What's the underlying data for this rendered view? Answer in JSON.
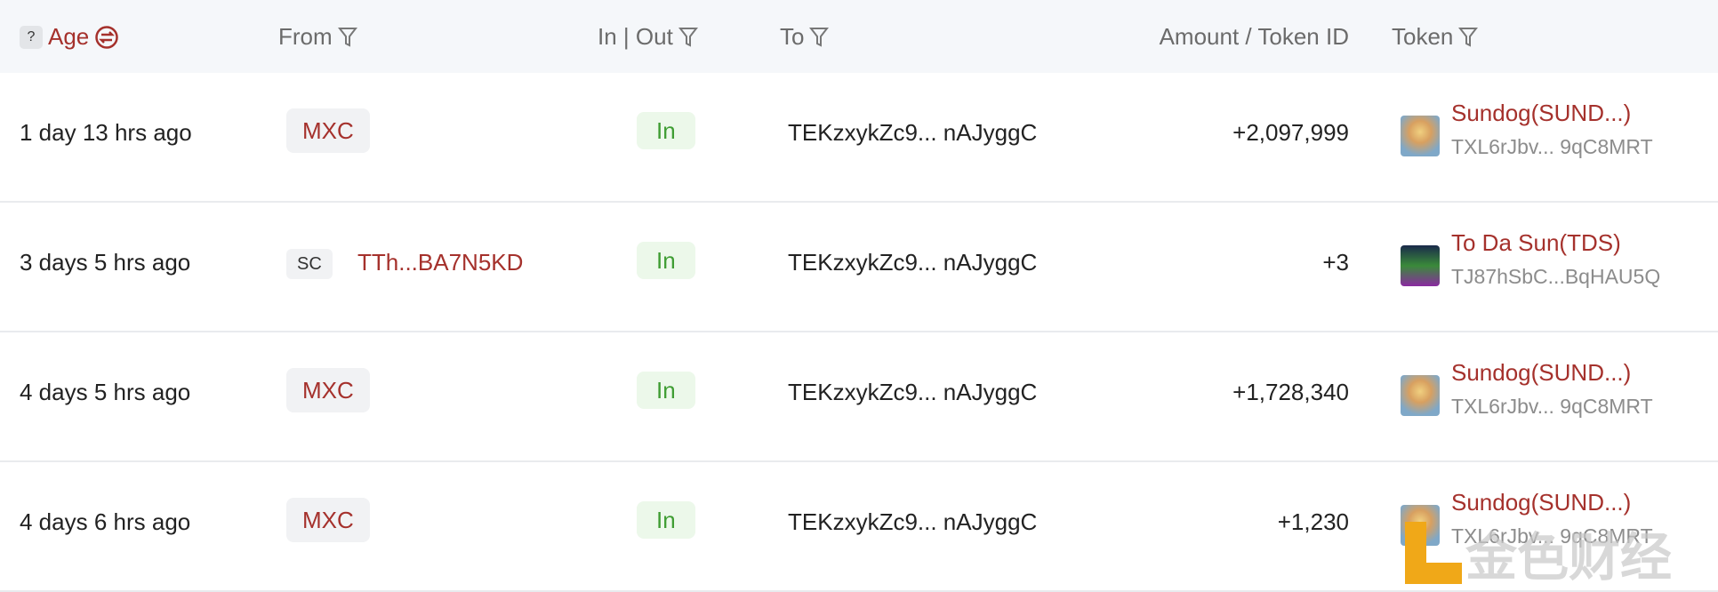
{
  "header": {
    "help": "?",
    "age": "Age",
    "from": "From",
    "inout": "In | Out",
    "to": "To",
    "amount": "Amount / Token ID",
    "token": "Token"
  },
  "colors": {
    "accent": "#a5312c",
    "in_green": "#3f9d33",
    "header_bg": "#f5f7fa"
  },
  "rows": [
    {
      "age": "1 day 13 hrs ago",
      "from_tag": "MXC",
      "direction": "In",
      "to": "TEKzxykZc9... nAJyggC",
      "amount": "+2,097,999",
      "token_name": "Sundog(SUND...)",
      "token_addr": "TXL6rJbv... 9qC8MRT",
      "token_icon": "sundog"
    },
    {
      "age": "3 days 5 hrs ago",
      "from_sc": "SC",
      "from_addr": "TTh...BA7N5KD",
      "direction": "In",
      "to": "TEKzxykZc9... nAJyggC",
      "amount": "+3",
      "token_name": "To Da Sun(TDS)",
      "token_addr": "TJ87hSbC...BqHAU5Q",
      "token_icon": "tds"
    },
    {
      "age": "4 days 5 hrs ago",
      "from_tag": "MXC",
      "direction": "In",
      "to": "TEKzxykZc9... nAJyggC",
      "amount": "+1,728,340",
      "token_name": "Sundog(SUND...)",
      "token_addr": "TXL6rJbv... 9qC8MRT",
      "token_icon": "sundog"
    },
    {
      "age": "4 days 6 hrs ago",
      "from_tag": "MXC",
      "direction": "In",
      "to": "TEKzxykZc9... nAJyggC",
      "amount": "+1,230",
      "token_name": "Sundog(SUND...)",
      "token_addr": "TXL6rJbv... 9qC8MRT",
      "token_icon": "sundog"
    }
  ],
  "watermark": "金色财经"
}
